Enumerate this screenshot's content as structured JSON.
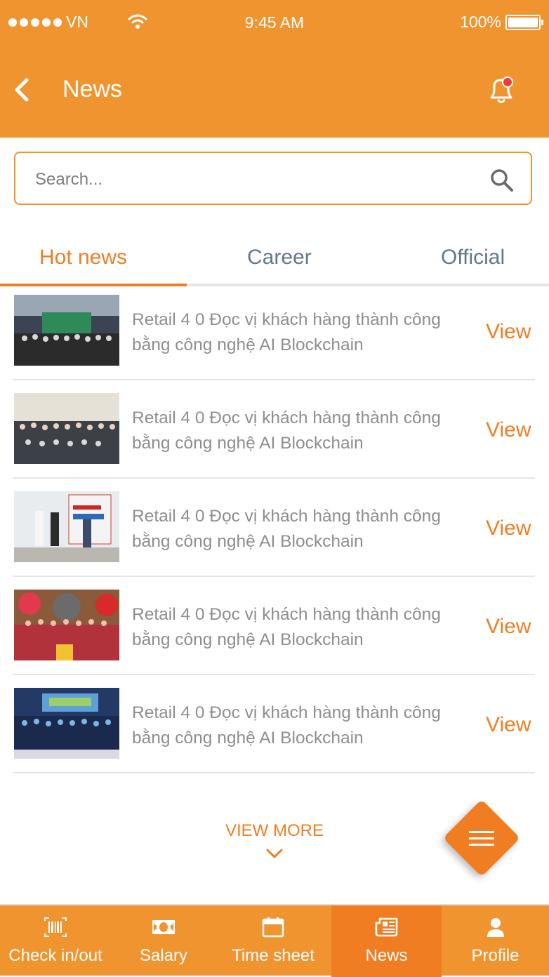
{
  "status_bar": {
    "carrier": "VN",
    "time": "9:45 AM",
    "battery": "100%"
  },
  "header": {
    "title": "News",
    "back_icon": "chevron-left-icon",
    "notification_icon": "bell-icon",
    "has_unread": true
  },
  "search": {
    "placeholder": "Search...",
    "value": ""
  },
  "tabs": [
    {
      "label": "Hot news",
      "active": true
    },
    {
      "label": "Career",
      "active": false
    },
    {
      "label": "Official",
      "active": false
    }
  ],
  "news": [
    {
      "title": "Retail 4 0 Đọc vị khách hàng thành công bằng công nghệ AI Blockchain",
      "action": "View"
    },
    {
      "title": "Retail 4 0 Đọc vị khách hàng thành công bằng công nghệ AI Blockchain",
      "action": "View"
    },
    {
      "title": "Retail 4 0 Đọc vị khách hàng thành công bằng công nghệ AI Blockchain",
      "action": "View"
    },
    {
      "title": "Retail 4 0 Đọc vị khách hàng thành công bằng công nghệ AI Blockchain",
      "action": "View"
    },
    {
      "title": "Retail 4 0 Đọc vị khách hàng thành công bằng công nghệ AI Blockchain",
      "action": "View"
    }
  ],
  "view_more": "VIEW MORE",
  "bottom_nav": [
    {
      "label": "Check in/out",
      "icon": "barcode-icon",
      "active": false
    },
    {
      "label": "Salary",
      "icon": "money-icon",
      "active": false
    },
    {
      "label": "Time sheet",
      "icon": "calendar-icon",
      "active": false
    },
    {
      "label": "News",
      "icon": "newspaper-icon",
      "active": true
    },
    {
      "label": "Profile",
      "icon": "user-icon",
      "active": false
    }
  ],
  "colors": {
    "primary": "#f0942f",
    "accent": "#f07d22",
    "badge": "#ee3b3b",
    "text_muted": "#8e8e8e",
    "tab_inactive": "#60788a"
  }
}
